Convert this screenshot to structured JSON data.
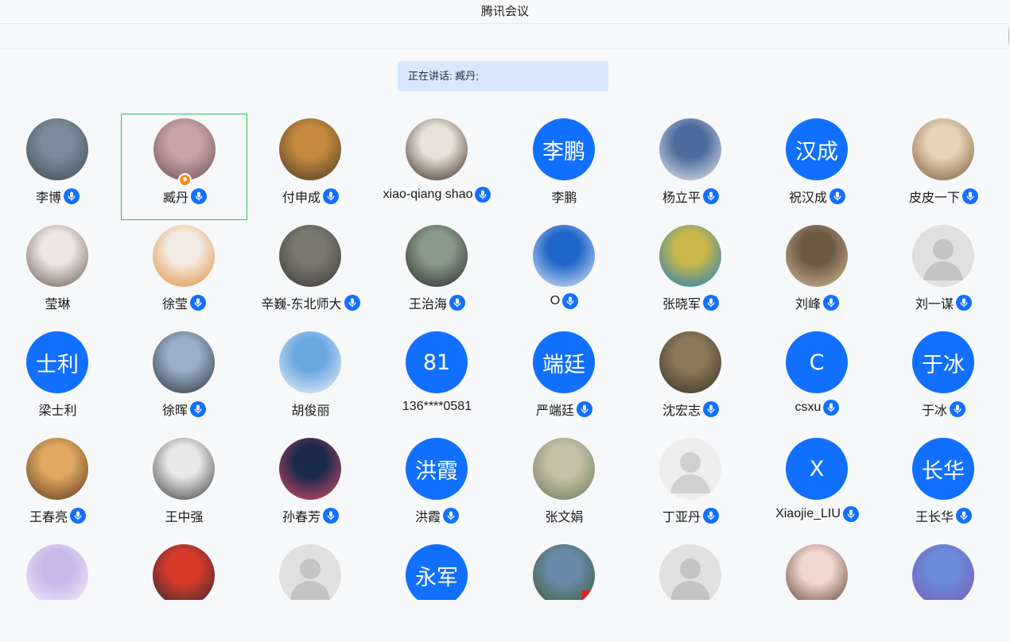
{
  "app": {
    "title": "腾讯会议"
  },
  "speaking": {
    "text": "正在讲话: 臧丹;"
  },
  "participants": [
    {
      "name": "李博",
      "avatar": {
        "type": "photo",
        "colors": [
          "#7a8c9a",
          "#3d4a52"
        ]
      },
      "mic": true
    },
    {
      "name": "臧丹",
      "avatar": {
        "type": "photo",
        "colors": [
          "#c9a4a6",
          "#6b4f58"
        ]
      },
      "mic": true,
      "active": true,
      "host_badge": true
    },
    {
      "name": "付申成",
      "avatar": {
        "type": "photo",
        "colors": [
          "#c58a3e",
          "#4a3a26"
        ]
      },
      "mic": true
    },
    {
      "name": "xiao-qiang shao",
      "avatar": {
        "type": "photo",
        "colors": [
          "#e8e2d8",
          "#3a2a20"
        ]
      },
      "mic": true
    },
    {
      "name": "李鹏",
      "avatar": {
        "type": "text",
        "text": "李鹏"
      },
      "mic": false
    },
    {
      "name": "杨立平",
      "avatar": {
        "type": "photo",
        "colors": [
          "#4d6a9c",
          "#e8ecf2"
        ]
      },
      "mic": true
    },
    {
      "name": "祝汉成",
      "avatar": {
        "type": "text",
        "text": "汉成"
      },
      "mic": true
    },
    {
      "name": "皮皮一下",
      "avatar": {
        "type": "photo",
        "colors": [
          "#e8d3b8",
          "#7a5a3a"
        ]
      },
      "mic": true
    },
    {
      "name": "莹琳",
      "avatar": {
        "type": "photo",
        "colors": [
          "#efe6e4",
          "#6a5a50"
        ]
      },
      "mic": false
    },
    {
      "name": "徐莹",
      "avatar": {
        "type": "photo",
        "colors": [
          "#f3ece2",
          "#e28a3a"
        ]
      },
      "mic": true
    },
    {
      "name": "辛巍-东北师大",
      "avatar": {
        "type": "photo",
        "colors": [
          "#7a7a70",
          "#3a3a34"
        ]
      },
      "mic": true
    },
    {
      "name": "王治海",
      "avatar": {
        "type": "photo",
        "colors": [
          "#8a9a8a",
          "#2a2a2a"
        ]
      },
      "mic": true
    },
    {
      "name": "O",
      "avatar": {
        "type": "photo",
        "colors": [
          "#1f66c8",
          "#dfe9f7"
        ]
      },
      "mic": true
    },
    {
      "name": "张晓军",
      "avatar": {
        "type": "photo",
        "colors": [
          "#c8b84a",
          "#1a7ac0"
        ]
      },
      "mic": true
    },
    {
      "name": "刘峰",
      "avatar": {
        "type": "photo",
        "colors": [
          "#6a5a44",
          "#d8b898"
        ]
      },
      "mic": true
    },
    {
      "name": "刘一谋",
      "avatar": {
        "type": "placeholder"
      },
      "mic": true
    },
    {
      "name": "梁士利",
      "avatar": {
        "type": "text",
        "text": "士利"
      },
      "mic": false
    },
    {
      "name": "徐晖",
      "avatar": {
        "type": "photo",
        "colors": [
          "#9ab0c8",
          "#2a3440"
        ]
      },
      "mic": true
    },
    {
      "name": "胡俊丽",
      "avatar": {
        "type": "photo",
        "colors": [
          "#6aa6e0",
          "#f0f4f8"
        ]
      },
      "mic": false
    },
    {
      "name": "136****0581",
      "avatar": {
        "type": "text",
        "text": "81"
      },
      "mic": false
    },
    {
      "name": "严端廷",
      "avatar": {
        "type": "text",
        "text": "端廷"
      },
      "mic": true
    },
    {
      "name": "沈宏志",
      "avatar": {
        "type": "photo",
        "colors": [
          "#8a7a5a",
          "#3a3024"
        ]
      },
      "mic": true
    },
    {
      "name": "csxu",
      "avatar": {
        "type": "text",
        "text": "C"
      },
      "mic": true
    },
    {
      "name": "于冰",
      "avatar": {
        "type": "text",
        "text": "于冰"
      },
      "mic": true
    },
    {
      "name": "王春亮",
      "avatar": {
        "type": "photo",
        "colors": [
          "#e0a860",
          "#5a3a20"
        ]
      },
      "mic": true
    },
    {
      "name": "王中强",
      "avatar": {
        "type": "photo",
        "colors": [
          "#e8e8e8",
          "#3a3a3a"
        ]
      },
      "mic": false
    },
    {
      "name": "孙春芳",
      "avatar": {
        "type": "photo",
        "colors": [
          "#1a2a4a",
          "#e04a6a"
        ]
      },
      "mic": true
    },
    {
      "name": "洪霞",
      "avatar": {
        "type": "text",
        "text": "洪霞"
      },
      "mic": true
    },
    {
      "name": "张文娟",
      "avatar": {
        "type": "photo",
        "colors": [
          "#c8c0a8",
          "#6a7a5a"
        ]
      },
      "mic": false
    },
    {
      "name": "丁亚丹",
      "avatar": {
        "type": "placeholder_light"
      },
      "mic": true
    },
    {
      "name": "Xiaojie_LIU",
      "avatar": {
        "type": "text",
        "text": "X"
      },
      "mic": true
    },
    {
      "name": "王长华",
      "avatar": {
        "type": "text",
        "text": "长华"
      },
      "mic": true
    },
    {
      "name": "",
      "avatar": {
        "type": "photo",
        "colors": [
          "#c8b8e8",
          "#f8f0ff"
        ]
      },
      "mic": false
    },
    {
      "name": "",
      "avatar": {
        "type": "photo",
        "colors": [
          "#d83a2a",
          "#2a2a2a"
        ]
      },
      "mic": false
    },
    {
      "name": "",
      "avatar": {
        "type": "placeholder"
      },
      "mic": false
    },
    {
      "name": "",
      "avatar": {
        "type": "text",
        "text": "永军"
      },
      "mic": false
    },
    {
      "name": "",
      "avatar": {
        "type": "photo",
        "colors": [
          "#6a8aaa",
          "#3a5a2a"
        ],
        "flag": true
      },
      "mic": false
    },
    {
      "name": "",
      "avatar": {
        "type": "placeholder"
      },
      "mic": false
    },
    {
      "name": "",
      "avatar": {
        "type": "photo",
        "colors": [
          "#f0d8d0",
          "#5a3a2a"
        ]
      },
      "mic": false
    },
    {
      "name": "",
      "avatar": {
        "type": "photo",
        "colors": [
          "#6a8ad8",
          "#7a5ab8"
        ]
      },
      "mic": false
    }
  ]
}
